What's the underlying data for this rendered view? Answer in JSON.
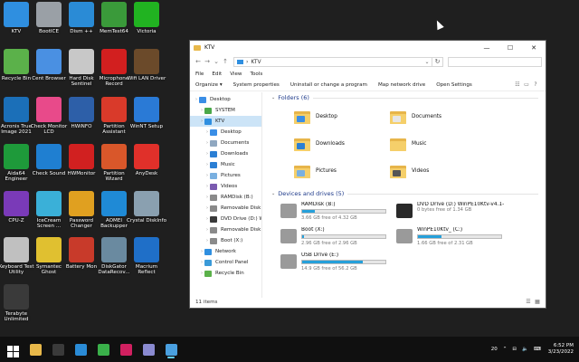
{
  "desktop": {
    "icons": [
      {
        "label": "KTV",
        "icon": "computer-icon",
        "color": "#2f8fe0"
      },
      {
        "label": "BootICE",
        "icon": "bootice-icon",
        "color": "#9aa0a6"
      },
      {
        "label": "Dism ++",
        "icon": "gears-icon",
        "color": "#2a8bd6"
      },
      {
        "label": "MemTest64",
        "icon": "memory-icon",
        "color": "#3a9a3a"
      },
      {
        "label": "Victoria",
        "icon": "green-plus-icon",
        "color": "#21b321"
      },
      {
        "label": "Recycle Bin",
        "icon": "recycle-bin-icon",
        "color": "#5bb14a"
      },
      {
        "label": "Cent Browser",
        "icon": "browser-icon",
        "color": "#4a90e2"
      },
      {
        "label": "Hard Disk Sentinel",
        "icon": "disk-sentinel-icon",
        "color": "#c8c8c8"
      },
      {
        "label": "Microphone Record",
        "icon": "microphone-icon",
        "color": "#d21f1f"
      },
      {
        "label": "Wifi LAN Driver",
        "icon": "router-icon",
        "color": "#6b4a2a"
      },
      {
        "label": "Acronis True Image 2021",
        "icon": "acronis-icon",
        "color": "#1b6fb8"
      },
      {
        "label": "Check Monitor LCD",
        "icon": "monitor-color-icon",
        "color": "#e84a8a"
      },
      {
        "label": "HWiNFO",
        "icon": "hwinfo-icon",
        "color": "#2d5fa8"
      },
      {
        "label": "Partition Assistant",
        "icon": "partition-icon",
        "color": "#d93a2a"
      },
      {
        "label": "WinNT Setup",
        "icon": "windows-setup-icon",
        "color": "#2a7ad6"
      },
      {
        "label": "Aida64 Engineer",
        "icon": "aida64-icon",
        "color": "#1e9a3a"
      },
      {
        "label": "Check Sound",
        "icon": "speaker-icon",
        "color": "#1f7fd1"
      },
      {
        "label": "HWMonitor",
        "icon": "hwmonitor-icon",
        "color": "#d12020"
      },
      {
        "label": "Partition Wizard",
        "icon": "wizard-icon",
        "color": "#d9572a"
      },
      {
        "label": "AnyDesk",
        "icon": "anydesk-icon",
        "color": "#e0302a"
      },
      {
        "label": "CPU-Z",
        "icon": "cpu-icon",
        "color": "#7a3ab8"
      },
      {
        "label": "IceCream Screen ...",
        "icon": "icecream-icon",
        "color": "#3ab0d8"
      },
      {
        "label": "Password Changer",
        "icon": "key-icon",
        "color": "#e0a020"
      },
      {
        "label": "AOMEI Backupper",
        "icon": "backup-icon",
        "color": "#1f8ad6"
      },
      {
        "label": "Crystal DiskInfo",
        "icon": "crystal-disk-icon",
        "color": "#8aa0b0"
      },
      {
        "label": "Keyboard Test Utility",
        "icon": "keyboard-icon",
        "color": "#c0c0c0"
      },
      {
        "label": "Symantec Ghost",
        "icon": "ghost-icon",
        "color": "#e0c030"
      },
      {
        "label": "Battery Mon",
        "icon": "battery-icon",
        "color": "#c83a2a"
      },
      {
        "label": "DiskGator DataRecov...",
        "icon": "diskgator-icon",
        "color": "#6a8aa0"
      },
      {
        "label": "Macrium Reflect",
        "icon": "macrium-icon",
        "color": "#1f6fc8"
      },
      {
        "label": "Terabyte Unlimited",
        "icon": "terabyte-icon",
        "color": "#3a3a3a"
      }
    ]
  },
  "window": {
    "title": "KTV",
    "address": "KTV",
    "address_prefix": "›",
    "controls": {
      "minimize": "—",
      "maximize": "☐",
      "close": "✕"
    },
    "menu": [
      "File",
      "Edit",
      "View",
      "Tools"
    ],
    "commands": {
      "organize": "Organize ▾",
      "system_properties": "System properties",
      "uninstall": "Uninstall or change a program",
      "map_drive": "Map network drive",
      "open_settings": "Open Settings"
    },
    "nav_items": [
      {
        "label": "Desktop",
        "icon": "desktop-folder-icon",
        "color": "#3a8ee6",
        "indent": 0,
        "selected": false
      },
      {
        "label": "SYSTEM",
        "icon": "user-icon",
        "color": "#4aa84a",
        "indent": 1,
        "selected": false
      },
      {
        "label": "KTV",
        "icon": "computer-icon",
        "color": "#2f8fe0",
        "indent": 1,
        "selected": true
      },
      {
        "label": "Desktop",
        "icon": "desktop-folder-icon",
        "color": "#3a8ee6",
        "indent": 2,
        "selected": false
      },
      {
        "label": "Documents",
        "icon": "documents-icon",
        "color": "#8fa7c0",
        "indent": 2,
        "selected": false
      },
      {
        "label": "Downloads",
        "icon": "downloads-icon",
        "color": "#2b7fd4",
        "indent": 2,
        "selected": false
      },
      {
        "label": "Music",
        "icon": "music-icon",
        "color": "#2b7fd4",
        "indent": 2,
        "selected": false
      },
      {
        "label": "Pictures",
        "icon": "pictures-icon",
        "color": "#7ab0e0",
        "indent": 2,
        "selected": false
      },
      {
        "label": "Videos",
        "icon": "videos-icon",
        "color": "#7a5ab0",
        "indent": 2,
        "selected": false
      },
      {
        "label": "RAMDisk (B:)",
        "icon": "drive-icon",
        "color": "#8a8a8a",
        "indent": 2,
        "selected": false
      },
      {
        "label": "Removable Disk (C:)",
        "icon": "removable-drive-icon",
        "color": "#8a8a8a",
        "indent": 2,
        "selected": false
      },
      {
        "label": "DVD Drive (D:) WinPE",
        "icon": "dvd-drive-icon",
        "color": "#3a3a3a",
        "indent": 2,
        "selected": false
      },
      {
        "label": "Removable Disk (E:)",
        "icon": "removable-drive-icon",
        "color": "#8a8a8a",
        "indent": 2,
        "selected": false
      },
      {
        "label": "Boot (X:)",
        "icon": "drive-icon",
        "color": "#8a8a8a",
        "indent": 2,
        "selected": false
      },
      {
        "label": "Network",
        "icon": "network-icon",
        "color": "#2f8fe0",
        "indent": 1,
        "selected": false
      },
      {
        "label": "Control Panel",
        "icon": "control-panel-icon",
        "color": "#3a9ad8",
        "indent": 1,
        "selected": false
      },
      {
        "label": "Recycle Bin",
        "icon": "recycle-bin-icon",
        "color": "#5bb14a",
        "indent": 1,
        "selected": false
      }
    ],
    "folders_header": "Folders (6)",
    "folders": [
      {
        "label": "Desktop",
        "icon": "desktop-folder-icon",
        "badge": "#3a8ee6"
      },
      {
        "label": "Documents",
        "icon": "documents-folder-icon",
        "badge": "#e6e6e6"
      },
      {
        "label": "Downloads",
        "icon": "downloads-folder-icon",
        "badge": "#2b7fd4"
      },
      {
        "label": "Music",
        "icon": "music-folder-icon",
        "badge": "#f5cf6a"
      },
      {
        "label": "Pictures",
        "icon": "pictures-folder-icon",
        "badge": "#7ab0e0"
      },
      {
        "label": "Videos",
        "icon": "videos-folder-icon",
        "badge": "#555555"
      }
    ],
    "drives_header": "Devices and drives (5)",
    "drives": [
      {
        "label": "RAMDisk (B:)",
        "icon": "drive-icon",
        "free": "3.66 GB free of 4.32 GB",
        "used_fraction": 0.15,
        "has_bar": true,
        "color": "#9a9a9a"
      },
      {
        "label": "DVD Drive (D:) WinPE10Ktv-v4.1-Final-2022",
        "icon": "dvd-rom-icon",
        "free": "0 bytes free of 1.34 GB",
        "used_fraction": 1,
        "has_bar": false,
        "color": "#2a2a2a"
      },
      {
        "label": "Boot (X:)",
        "icon": "drive-icon",
        "free": "2.96 GB free of 2.96 GB",
        "used_fraction": 0.02,
        "has_bar": true,
        "color": "#9a9a9a"
      },
      {
        "label": "WinPE10Ktv_ (C:)",
        "icon": "usb-drive-icon",
        "free": "1.66 GB free of 2.31 GB",
        "used_fraction": 0.28,
        "has_bar": true,
        "color": "#9a9a9a"
      },
      {
        "label": "USB Drive (E:)",
        "icon": "usb-drive-icon",
        "free": "14.9 GB free of 56.2 GB",
        "used_fraction": 0.73,
        "has_bar": true,
        "color": "#9a9a9a"
      }
    ],
    "status": "11 items"
  },
  "taskbar": {
    "apps": [
      {
        "icon": "start-icon",
        "color": "#ffffff",
        "active": false
      },
      {
        "icon": "file-explorer-icon",
        "color": "#e8b84a",
        "active": false
      },
      {
        "icon": "terminal-icon",
        "color": "#3a3a3a",
        "active": false
      },
      {
        "icon": "dism-icon",
        "color": "#2a8bd6",
        "active": false
      },
      {
        "icon": "paint-icon",
        "color": "#3ab04a",
        "active": false
      },
      {
        "icon": "media-icon",
        "color": "#d12060",
        "active": false
      },
      {
        "icon": "screen-icon",
        "color": "#8a8ad0",
        "active": false
      },
      {
        "icon": "explorer-window-icon",
        "color": "#4aa0e0",
        "active": true
      }
    ],
    "tray": {
      "badge": "20",
      "time": "6:52 PM",
      "date": "3/23/2022"
    }
  }
}
